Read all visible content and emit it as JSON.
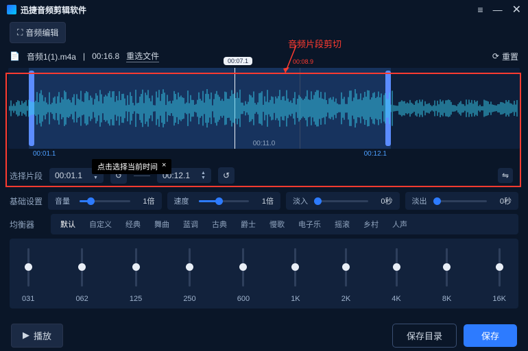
{
  "app_title": "迅捷音频剪辑软件",
  "toolbar_edit": "音频编辑",
  "file": {
    "name": "音频1(1).m4a",
    "duration": "00:16.8",
    "reselect": "重选文件",
    "reset": "重置"
  },
  "annotation": "音频片段剪切",
  "waveform": {
    "playhead_time": "00:07.1",
    "marker_time": "00:08.9",
    "axis_label": "00:11.0",
    "sel_start_label": "00:01.1",
    "sel_end_label": "00:12.1"
  },
  "tooltip": {
    "text": "点击选择当前时间",
    "close": "×"
  },
  "select_clip": {
    "label": "选择片段",
    "start": "00:01.1",
    "end": "00:12.1"
  },
  "basic": {
    "label": "基础设置",
    "volume": {
      "name": "音量",
      "value": "1倍",
      "pct": 22
    },
    "speed": {
      "name": "速度",
      "value": "1倍",
      "pct": 40
    },
    "fadein": {
      "name": "淡入",
      "value": "0秒",
      "pct": 0
    },
    "fadeout": {
      "name": "淡出",
      "value": "0秒",
      "pct": 0
    }
  },
  "eq": {
    "label": "均衡器",
    "tabs": [
      "默认",
      "自定义",
      "经典",
      "舞曲",
      "蓝调",
      "古典",
      "爵士",
      "慢歌",
      "电子乐",
      "摇滚",
      "乡村",
      "人声"
    ],
    "bands": [
      "031",
      "062",
      "125",
      "250",
      "600",
      "1K",
      "2K",
      "4K",
      "8K",
      "16K"
    ]
  },
  "footer": {
    "play": "播放",
    "save_dir": "保存目录",
    "save": "保存"
  }
}
